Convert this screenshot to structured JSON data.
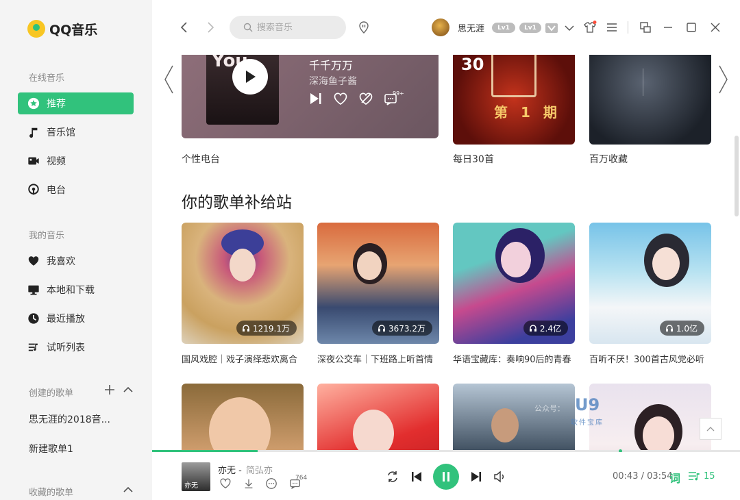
{
  "app": {
    "name": "QQ音乐"
  },
  "sidebar": {
    "online_title": "在线音乐",
    "online_items": [
      {
        "label": "推荐",
        "icon": "star-icon",
        "active": true
      },
      {
        "label": "音乐馆",
        "icon": "music-note-icon",
        "active": false
      },
      {
        "label": "视频",
        "icon": "video-icon",
        "active": false
      },
      {
        "label": "电台",
        "icon": "radio-icon",
        "active": false
      }
    ],
    "my_title": "我的音乐",
    "my_items": [
      {
        "label": "我喜欢",
        "icon": "heart-icon"
      },
      {
        "label": "本地和下载",
        "icon": "monitor-icon"
      },
      {
        "label": "最近播放",
        "icon": "clock-icon"
      },
      {
        "label": "试听列表",
        "icon": "playlist-icon"
      }
    ],
    "created_title": "创建的歌单",
    "created_playlists": [
      "思无涯的2018音...",
      "新建歌单1"
    ],
    "collected_title": "收藏的歌单"
  },
  "topbar": {
    "search_placeholder": "搜索音乐",
    "username": "思无涯",
    "badges": [
      "Lv1",
      "Lv1"
    ]
  },
  "featured": {
    "radio": {
      "cover_text": "You",
      "title": "千千万万",
      "artist": "深海鱼子酱",
      "label": "个性电台",
      "comment_count": "99+"
    },
    "daily": {
      "label": "每日30首",
      "cover_num": "30",
      "cover_title": "第 1 期"
    },
    "million": {
      "label": "百万收藏"
    }
  },
  "section": {
    "title": "你的歌单补给站"
  },
  "playlists": [
    {
      "name": "国风戏腔｜戏子演绎悲欢离合",
      "count": "1219.1万"
    },
    {
      "name": "深夜公交车｜下班路上听首情",
      "count": "3673.2万"
    },
    {
      "name": "华语宝藏库：奏响90后的青春",
      "count": "2.4亿"
    },
    {
      "name": "百听不厌！300首古风党必听",
      "count": "1.0亿"
    },
    {
      "name": "",
      "count": ""
    },
    {
      "name": "",
      "count": ""
    },
    {
      "name": "",
      "count": ""
    },
    {
      "name": "",
      "count": ""
    }
  ],
  "watermark": {
    "gzh": "公众号：",
    "brand": "U9",
    "sub": "软件宝库"
  },
  "player": {
    "cover_text": "亦无",
    "title": "亦无 -",
    "artist": "简弘亦",
    "comment_count": "764",
    "current_time": "00:43",
    "total_time": "03:54",
    "time_display": "00:43 / 03:54",
    "progress": 0.18,
    "lyric_label": "词",
    "queue_count": "15"
  },
  "colors": {
    "accent": "#31c27c",
    "sidebar_bg": "#f4f4f4"
  }
}
